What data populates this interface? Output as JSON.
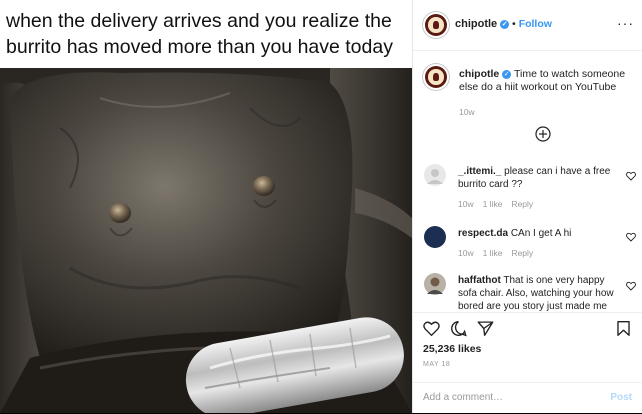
{
  "meme": {
    "caption": "when the delivery arrives and you realize the burrito has moved more than you have today"
  },
  "header": {
    "username": "chipotle",
    "dot": "•",
    "follow_label": "Follow",
    "more": "···"
  },
  "post": {
    "username": "chipotle",
    "text": "Time to watch someone else do a hiit workout on YouTube",
    "age": "10w"
  },
  "comments": [
    {
      "username": "_.ittemi._",
      "text": "please can i have a free burrito card ??",
      "age": "10w",
      "likes": "1 like",
      "reply": "Reply"
    },
    {
      "username": "respect.da",
      "text": "CAn I get A hi",
      "age": "10w",
      "likes": "1 like",
      "reply": "Reply"
    },
    {
      "username": "haffathot",
      "text": "That is one very happy sofa chair. Also, watching your how bored are you story just made me"
    }
  ],
  "footer": {
    "likes": "25,236 likes",
    "date": "MAY 18",
    "comment_placeholder": "Add a comment…",
    "post_label": "Post"
  },
  "colors": {
    "accent": "#3897f0",
    "verified": "#3b97f0",
    "brand": "#5a1a12"
  }
}
